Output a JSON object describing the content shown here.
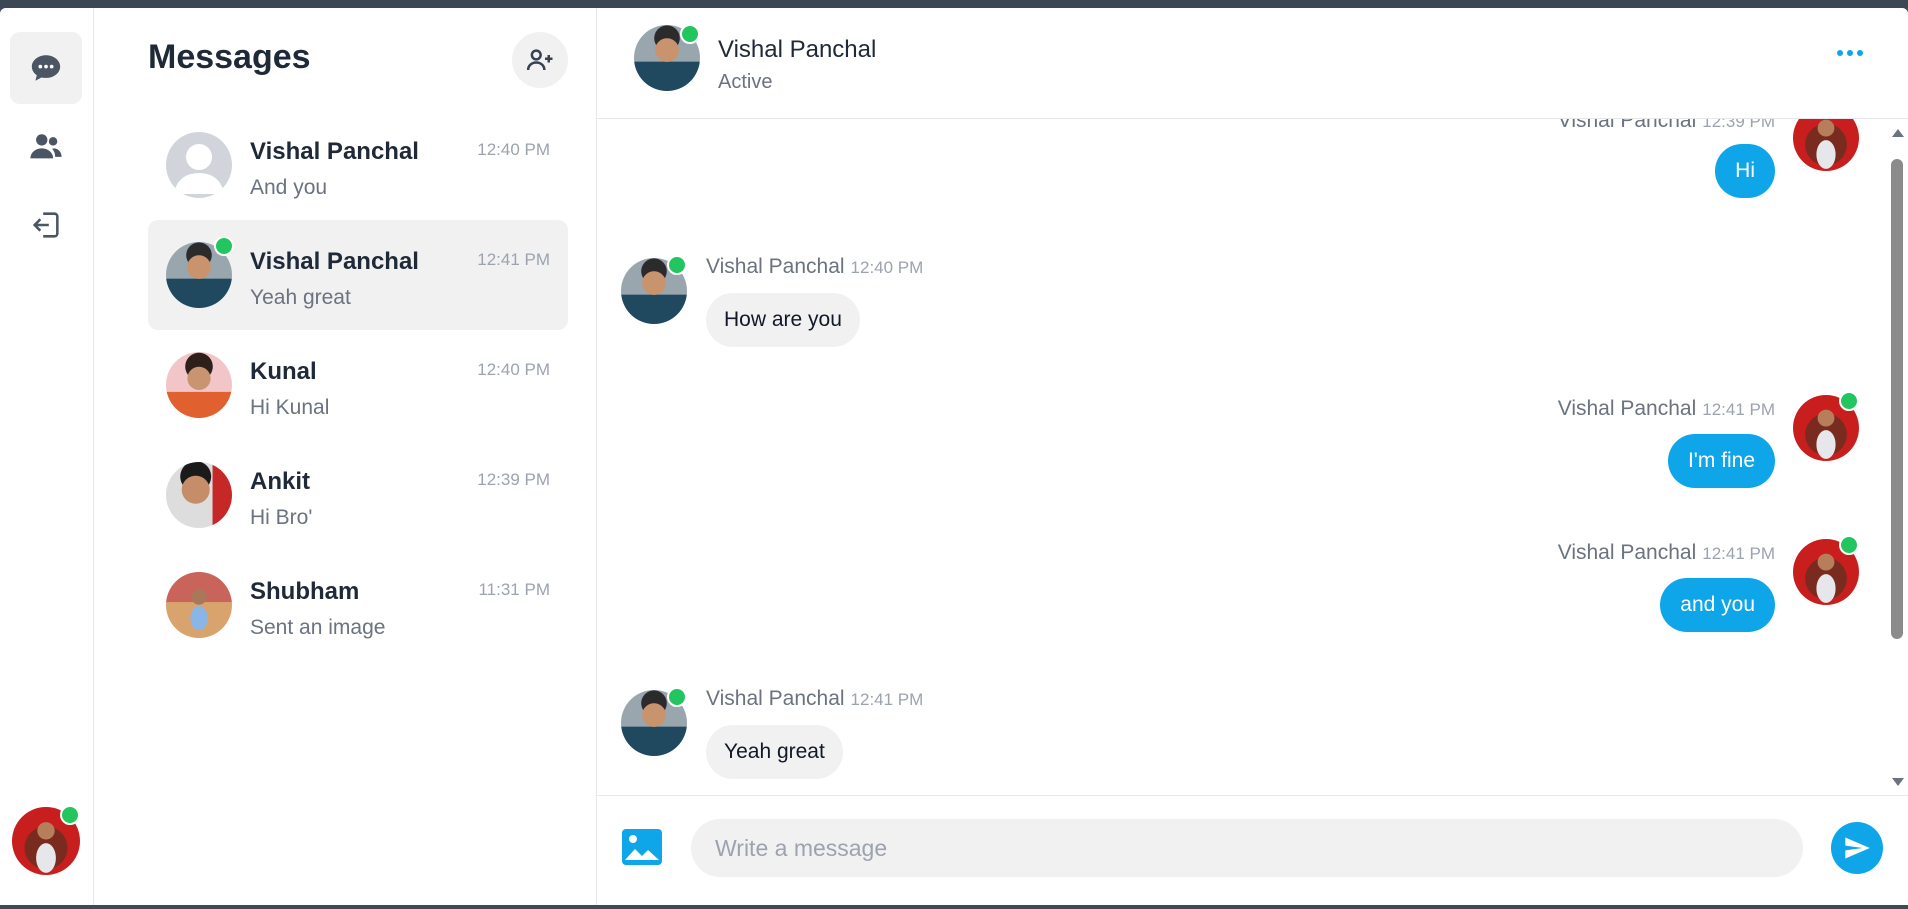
{
  "sidebar": {
    "items": [
      {
        "icon": "chat-bubble-icon",
        "active": true
      },
      {
        "icon": "users-icon",
        "active": false
      },
      {
        "icon": "logout-icon",
        "active": false
      }
    ],
    "user_online": true
  },
  "panel": {
    "title": "Messages",
    "add_icon": "add-user-icon",
    "conversations": [
      {
        "name": "Vishal Panchal",
        "preview": "And you",
        "time": "12:40 PM",
        "online": false,
        "active": false
      },
      {
        "name": "Vishal Panchal",
        "preview": "Yeah great",
        "time": "12:41 PM",
        "online": true,
        "active": true
      },
      {
        "name": "Kunal",
        "preview": "Hi Kunal",
        "time": "12:40 PM",
        "online": false,
        "active": false
      },
      {
        "name": "Ankit",
        "preview": "Hi Bro'",
        "time": "12:39 PM",
        "online": false,
        "active": false
      },
      {
        "name": "Shubham",
        "preview": "Sent an image",
        "time": "11:31 PM",
        "online": false,
        "active": false
      }
    ]
  },
  "chat": {
    "header": {
      "name": "Vishal Panchal",
      "status": "Active",
      "online": true,
      "more_icon": "more-dots-icon"
    },
    "messages": [
      {
        "sender": "Vishal Panchal",
        "time": "12:39 PM",
        "text": "Hi",
        "outgoing": true
      },
      {
        "sender": "Vishal Panchal",
        "time": "12:40 PM",
        "text": "How are you",
        "outgoing": false
      },
      {
        "sender": "Vishal Panchal",
        "time": "12:41 PM",
        "text": "I'm fine",
        "outgoing": true
      },
      {
        "sender": "Vishal Panchal",
        "time": "12:41 PM",
        "text": "and you",
        "outgoing": true
      },
      {
        "sender": "Vishal Panchal",
        "time": "12:41 PM",
        "text": "Yeah great",
        "outgoing": false
      }
    ]
  },
  "composer": {
    "placeholder": "Write a message",
    "value": "",
    "image_icon": "image-icon",
    "send_icon": "send-icon"
  },
  "colors": {
    "accent": "#0ea5e9",
    "online": "#22c55e",
    "bubble_in": "#f1f1f2"
  }
}
